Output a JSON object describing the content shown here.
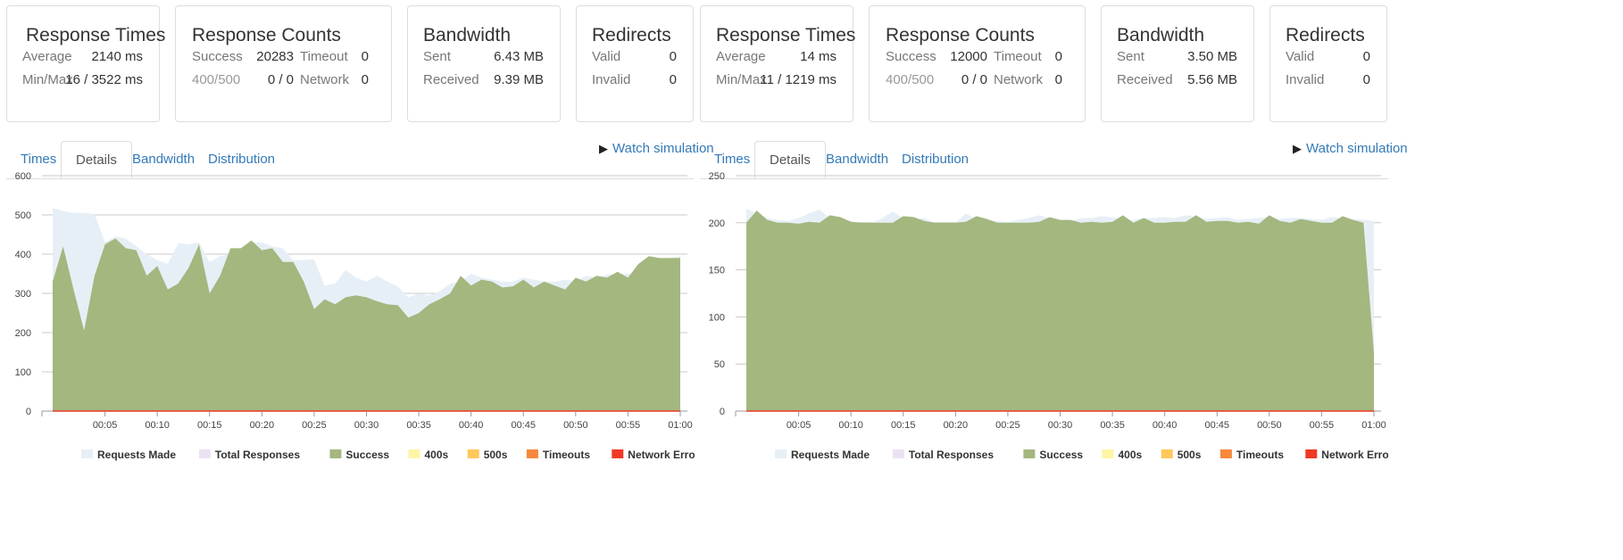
{
  "panels": [
    {
      "cards": {
        "response_times": {
          "title": "Response Times",
          "rows": [
            {
              "label": "Average",
              "value": "2140 ms"
            },
            {
              "label": "Min/Max",
              "value": "16 / 3522 ms"
            }
          ]
        },
        "response_counts": {
          "title": "Response Counts",
          "success_label": "Success",
          "success_value": "20283",
          "timeout_label": "Timeout",
          "timeout_value": "0",
          "err_label": "400/500",
          "err_value": "0 / 0",
          "network_label": "Network",
          "network_value": "0"
        },
        "bandwidth": {
          "title": "Bandwidth",
          "rows": [
            {
              "label": "Sent",
              "value": "6.43 MB"
            },
            {
              "label": "Received",
              "value": "9.39 MB"
            }
          ]
        },
        "redirects": {
          "title": "Redirects",
          "rows": [
            {
              "label": "Valid",
              "value": "0"
            },
            {
              "label": "Invalid",
              "value": "0"
            }
          ]
        }
      },
      "tabs": [
        "Times",
        "Details",
        "Bandwidth",
        "Distribution"
      ],
      "active_tab": "Details",
      "watch_label": "Watch simulation"
    },
    {
      "cards": {
        "response_times": {
          "title": "Response Times",
          "rows": [
            {
              "label": "Average",
              "value": "14 ms"
            },
            {
              "label": "Min/Max",
              "value": "11 / 1219 ms"
            }
          ]
        },
        "response_counts": {
          "title": "Response Counts",
          "success_label": "Success",
          "success_value": "12000",
          "timeout_label": "Timeout",
          "timeout_value": "0",
          "err_label": "400/500",
          "err_value": "0 / 0",
          "network_label": "Network",
          "network_value": "0"
        },
        "bandwidth": {
          "title": "Bandwidth",
          "rows": [
            {
              "label": "Sent",
              "value": "3.50 MB"
            },
            {
              "label": "Received",
              "value": "5.56 MB"
            }
          ]
        },
        "redirects": {
          "title": "Redirects",
          "rows": [
            {
              "label": "Valid",
              "value": "0"
            },
            {
              "label": "Invalid",
              "value": "0"
            }
          ]
        }
      },
      "tabs": [
        "Times",
        "Details",
        "Bandwidth",
        "Distribution"
      ],
      "active_tab": "Details",
      "watch_label": "Watch simulation"
    }
  ],
  "legend": [
    {
      "name": "Requests Made",
      "color": "#e7eff6"
    },
    {
      "name": "Total Responses",
      "color": "#ece1f2"
    },
    {
      "name": "Success",
      "color": "#a3b77f"
    },
    {
      "name": "400s",
      "color": "#fff5a5"
    },
    {
      "name": "500s",
      "color": "#ffc85a"
    },
    {
      "name": "Timeouts",
      "color": "#f7883c"
    },
    {
      "name": "Network Errors",
      "color": "#ee3a24"
    }
  ],
  "chart_data": [
    {
      "type": "area",
      "x_labels": [
        "00:05",
        "00:10",
        "00:15",
        "00:20",
        "00:25",
        "00:30",
        "00:35",
        "00:40",
        "00:45",
        "00:50",
        "00:55",
        "01:00"
      ],
      "x_range": [
        1,
        61
      ],
      "ylim": [
        0,
        600
      ],
      "y_ticks": [
        0,
        100,
        200,
        300,
        400,
        500,
        600
      ],
      "grid": true,
      "legend_position": "bottom",
      "series": [
        {
          "name": "Requests Made",
          "color": "#e7eff6",
          "x": [
            1,
            2,
            3,
            4,
            5,
            6,
            7,
            8,
            9,
            10,
            11,
            12,
            13,
            14,
            15,
            16,
            17,
            18,
            19,
            20,
            21,
            22,
            23,
            24,
            25,
            26,
            27,
            28,
            29,
            30,
            31,
            32,
            33,
            34,
            35,
            36,
            37,
            38,
            39,
            40,
            41,
            42,
            43,
            44,
            45,
            46,
            47,
            48,
            49,
            50,
            51,
            52,
            53,
            54,
            55,
            56,
            57,
            58,
            59,
            60,
            61
          ],
          "values": [
            518,
            510,
            505,
            505,
            502,
            430,
            445,
            440,
            420,
            400,
            385,
            375,
            428,
            425,
            430,
            380,
            395,
            400,
            415,
            430,
            430,
            420,
            415,
            385,
            385,
            387,
            320,
            325,
            360,
            340,
            330,
            345,
            330,
            318,
            290,
            300,
            295,
            305,
            325,
            330,
            350,
            340,
            335,
            330,
            330,
            340,
            335,
            330,
            330,
            335,
            330,
            345,
            340,
            348,
            350,
            350,
            350,
            370,
            385,
            390,
            395
          ]
        },
        {
          "name": "Success",
          "color": "#a3b77f",
          "x": [
            1,
            2,
            3,
            4,
            5,
            6,
            7,
            8,
            9,
            10,
            11,
            12,
            13,
            14,
            15,
            16,
            17,
            18,
            19,
            20,
            21,
            22,
            23,
            24,
            25,
            26,
            27,
            28,
            29,
            30,
            31,
            32,
            33,
            34,
            35,
            36,
            37,
            38,
            39,
            40,
            41,
            42,
            43,
            44,
            45,
            46,
            47,
            48,
            49,
            50,
            51,
            52,
            53,
            54,
            55,
            56,
            57,
            58,
            59,
            60,
            61
          ],
          "values": [
            330,
            420,
            310,
            205,
            345,
            425,
            440,
            415,
            410,
            345,
            370,
            310,
            325,
            365,
            425,
            300,
            345,
            415,
            415,
            435,
            410,
            415,
            380,
            380,
            330,
            260,
            285,
            272,
            290,
            295,
            290,
            280,
            272,
            270,
            238,
            250,
            272,
            285,
            300,
            345,
            320,
            335,
            330,
            315,
            318,
            335,
            315,
            330,
            320,
            310,
            340,
            330,
            345,
            340,
            355,
            340,
            375,
            395,
            390,
            390,
            390
          ]
        },
        {
          "name": "Timeouts",
          "color": "#f7883c",
          "values": [
            0
          ]
        },
        {
          "name": "Network Errors",
          "color": "#ee3a24",
          "values": [
            0
          ]
        }
      ]
    },
    {
      "type": "area",
      "x_labels": [
        "00:05",
        "00:10",
        "00:15",
        "00:20",
        "00:25",
        "00:30",
        "00:35",
        "00:40",
        "00:45",
        "00:50",
        "00:55",
        "01:00"
      ],
      "x_range": [
        1,
        61
      ],
      "ylim": [
        0,
        250
      ],
      "y_ticks": [
        0,
        50,
        100,
        150,
        200,
        250
      ],
      "grid": true,
      "legend_position": "bottom",
      "series": [
        {
          "name": "Requests Made",
          "color": "#e7eff6",
          "x": [
            1,
            2,
            3,
            4,
            5,
            6,
            7,
            8,
            9,
            10,
            11,
            12,
            13,
            14,
            15,
            16,
            17,
            18,
            19,
            20,
            21,
            22,
            23,
            24,
            25,
            26,
            27,
            28,
            29,
            30,
            31,
            32,
            33,
            34,
            35,
            36,
            37,
            38,
            39,
            40,
            41,
            42,
            43,
            44,
            45,
            46,
            47,
            48,
            49,
            50,
            51,
            52,
            53,
            54,
            55,
            56,
            57,
            58,
            59,
            60,
            61
          ],
          "values": [
            215,
            210,
            205,
            203,
            202,
            205,
            210,
            214,
            205,
            205,
            202,
            200,
            200,
            205,
            212,
            205,
            203,
            205,
            200,
            200,
            200,
            210,
            203,
            203,
            202,
            201,
            203,
            205,
            208,
            205,
            203,
            202,
            205,
            205,
            207,
            206,
            203,
            203,
            205,
            205,
            206,
            205,
            208,
            207,
            204,
            205,
            206,
            203,
            204,
            205,
            206,
            204,
            205,
            205,
            204,
            203,
            206,
            205,
            204,
            203,
            202
          ]
        },
        {
          "name": "Success",
          "color": "#a3b77f",
          "x": [
            1,
            2,
            3,
            4,
            5,
            6,
            7,
            8,
            9,
            10,
            11,
            12,
            13,
            14,
            15,
            16,
            17,
            18,
            19,
            20,
            21,
            22,
            23,
            24,
            25,
            26,
            27,
            28,
            29,
            30,
            31,
            32,
            33,
            34,
            35,
            36,
            37,
            38,
            39,
            40,
            41,
            42,
            43,
            44,
            45,
            46,
            47,
            48,
            49,
            50,
            51,
            52,
            53,
            54,
            55,
            56,
            57,
            58,
            59,
            60,
            61
          ],
          "values": [
            200,
            213,
            203,
            200,
            200,
            199,
            201,
            200,
            208,
            206,
            201,
            200,
            200,
            200,
            200,
            207,
            206,
            202,
            200,
            200,
            200,
            201,
            207,
            204,
            200,
            200,
            200,
            200,
            201,
            206,
            203,
            203,
            200,
            201,
            200,
            201,
            208,
            200,
            205,
            200,
            200,
            201,
            201,
            208,
            201,
            202,
            202,
            200,
            201,
            199,
            208,
            202,
            200,
            204,
            202,
            200,
            200,
            207,
            203,
            200,
            62
          ]
        },
        {
          "name": "Timeouts",
          "color": "#f7883c",
          "values": [
            0
          ]
        },
        {
          "name": "Network Errors",
          "color": "#ee3a24",
          "values": [
            0
          ]
        }
      ]
    }
  ]
}
